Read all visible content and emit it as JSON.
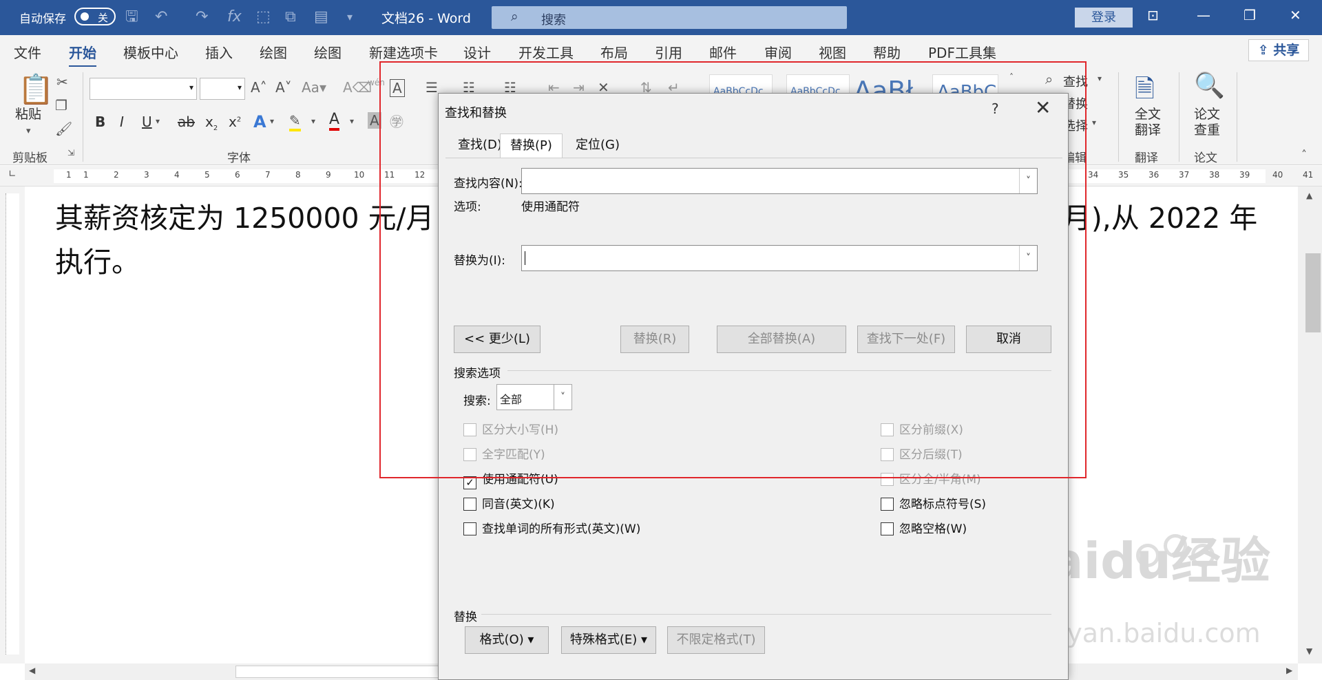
{
  "titlebar": {
    "autosave_label": "自动保存",
    "autosave_state": "关",
    "doc_title": "文档26  -  Word",
    "search_placeholder": "搜索",
    "login": "登录"
  },
  "ribbon_tabs": [
    "文件",
    "开始",
    "模板中心",
    "插入",
    "绘图",
    "绘图",
    "新建选项卡",
    "设计",
    "开发工具",
    "布局",
    "引用",
    "邮件",
    "审阅",
    "视图",
    "帮助",
    "PDF工具集"
  ],
  "active_tab": "开始",
  "share": "共享",
  "ribbon": {
    "clipboard": {
      "paste": "粘贴",
      "label": "剪贴板"
    },
    "font": {
      "label": "字体",
      "bold": "B",
      "italic": "I",
      "underline": "U",
      "strike": "ab",
      "sub": "x",
      "sup": "x"
    },
    "styles": [
      "AaBbCcDc",
      "AaBbCcDc",
      "AaBł",
      "AaBbC"
    ],
    "edit": {
      "find": "查找",
      "replace": "替换",
      "select": "选择",
      "label": "编辑"
    },
    "translate": {
      "btn1": "全文",
      "btn2": "翻译",
      "label": "翻译"
    },
    "paper": {
      "btn1": "论文",
      "btn2": "查重",
      "label": "论文"
    }
  },
  "ruler_numbers": [
    "1",
    "1",
    "2",
    "3",
    "4",
    "5",
    "6",
    "7",
    "8",
    "9",
    "10",
    "11",
    "12",
    "34",
    "35",
    "36",
    "37",
    "38",
    "39",
    "40",
    "41"
  ],
  "document": {
    "line1": "其薪资核定为 1250000 元/月",
    "line1_tail": "/月),从 2022 年",
    "line2": "执行。"
  },
  "dialog": {
    "title": "查找和替换",
    "help": "?",
    "tabs": [
      "查找(D)",
      "替换(P)",
      "定位(G)"
    ],
    "active_tab": "替换(P)",
    "find_label": "查找内容(N):",
    "find_value": "",
    "options_label": "选项:",
    "options_value": "使用通配符",
    "replace_label": "替换为(I):",
    "replace_value": "",
    "buttons": {
      "less": "<< 更少(L)",
      "replace": "替换(R)",
      "replace_all": "全部替换(A)",
      "find_next": "查找下一处(F)",
      "cancel": "取消"
    },
    "search_options_title": "搜索选项",
    "search_label": "搜索:",
    "search_value": "全部",
    "checks_left": [
      {
        "label": "区分大小写(H)",
        "checked": false,
        "disabled": true
      },
      {
        "label": "全字匹配(Y)",
        "checked": false,
        "disabled": true
      },
      {
        "label": "使用通配符(U)",
        "checked": true,
        "disabled": false
      },
      {
        "label": "同音(英文)(K)",
        "checked": false,
        "disabled": false
      },
      {
        "label": "查找单词的所有形式(英文)(W)",
        "checked": false,
        "disabled": false
      }
    ],
    "checks_right": [
      {
        "label": "区分前缀(X)",
        "checked": false,
        "disabled": true
      },
      {
        "label": "区分后缀(T)",
        "checked": false,
        "disabled": true
      },
      {
        "label": "区分全/半角(M)",
        "checked": false,
        "disabled": true
      },
      {
        "label": "忽略标点符号(S)",
        "checked": false,
        "disabled": false
      },
      {
        "label": "忽略空格(W)",
        "checked": false,
        "disabled": false
      }
    ],
    "replace_section_title": "替换",
    "format_buttons": {
      "format": "格式(O) ▾",
      "special": "特殊格式(E) ▾",
      "no_format": "不限定格式(T)"
    }
  },
  "watermark": {
    "brand": "Baidu经验",
    "url": "jingyan.baidu.com"
  },
  "colors": {
    "title_bar": "#2b579a",
    "highlight_box": "#e0262b"
  }
}
